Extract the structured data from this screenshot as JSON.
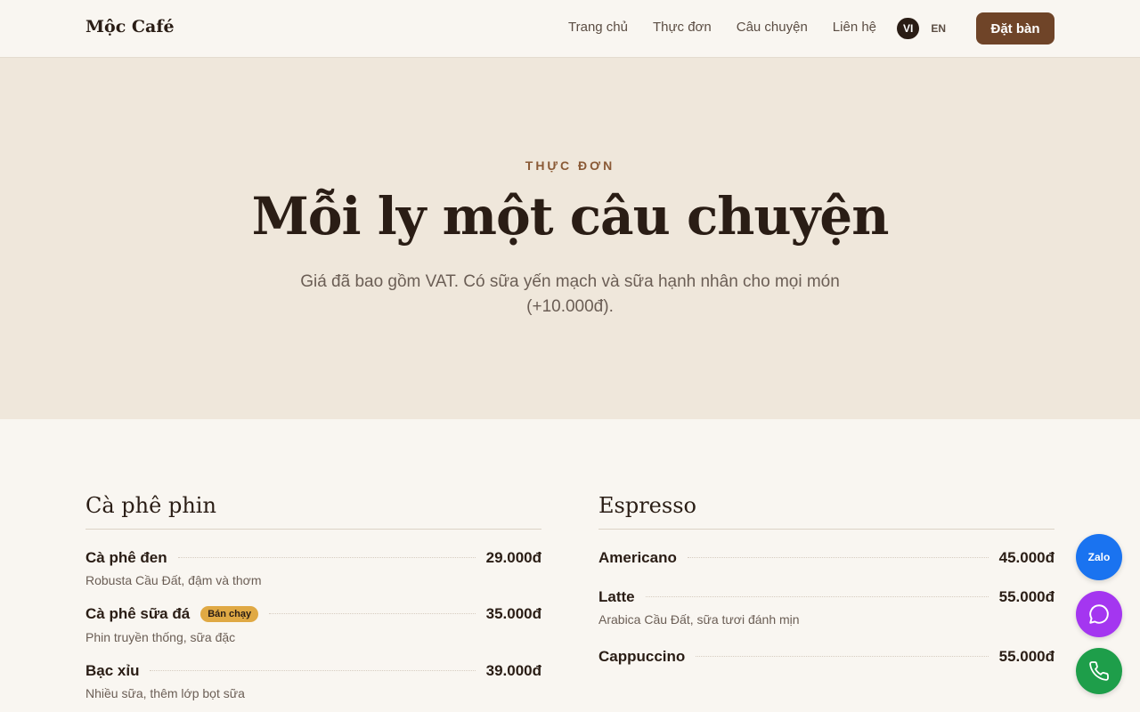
{
  "header": {
    "logo": "Mộc Café",
    "nav": [
      "Trang chủ",
      "Thực đơn",
      "Câu chuyện",
      "Liên hệ"
    ],
    "lang_vi": "VI",
    "lang_en": "EN",
    "book_label": "Đặt bàn"
  },
  "hero": {
    "eyebrow": "THỰC ĐƠN",
    "title": "Mỗi ly một câu chuyện",
    "subtitle": "Giá đã bao gồm VAT. Có sữa yến mạch và sữa hạnh nhân cho mọi món (+10.000đ)."
  },
  "menu": {
    "left": {
      "title": "Cà phê phin",
      "items": [
        {
          "name": "Cà phê đen",
          "price": "29.000đ",
          "desc": "Robusta Cầu Đất, đậm và thơm"
        },
        {
          "name": "Cà phê sữa đá",
          "badge": "Bán chạy",
          "price": "35.000đ",
          "desc": "Phin truyền thống, sữa đặc"
        },
        {
          "name": "Bạc xỉu",
          "price": "39.000đ",
          "desc": "Nhiều sữa, thêm lớp bọt sữa"
        }
      ]
    },
    "right": {
      "title": "Espresso",
      "items": [
        {
          "name": "Americano",
          "price": "45.000đ"
        },
        {
          "name": "Latte",
          "price": "55.000đ",
          "desc": "Arabica Cầu Đất, sữa tươi đánh mịn"
        },
        {
          "name": "Cappuccino",
          "price": "55.000đ"
        }
      ]
    }
  },
  "floating": {
    "zalo_label": "Zalo",
    "message_icon": "chat-bubble-icon",
    "phone_icon": "phone-icon"
  },
  "colors": {
    "brand": "#6f4428",
    "badge": "#e0a944",
    "zalo": "#1a73f0",
    "messenger": "#a436f0",
    "phone": "#1e9e4a"
  }
}
